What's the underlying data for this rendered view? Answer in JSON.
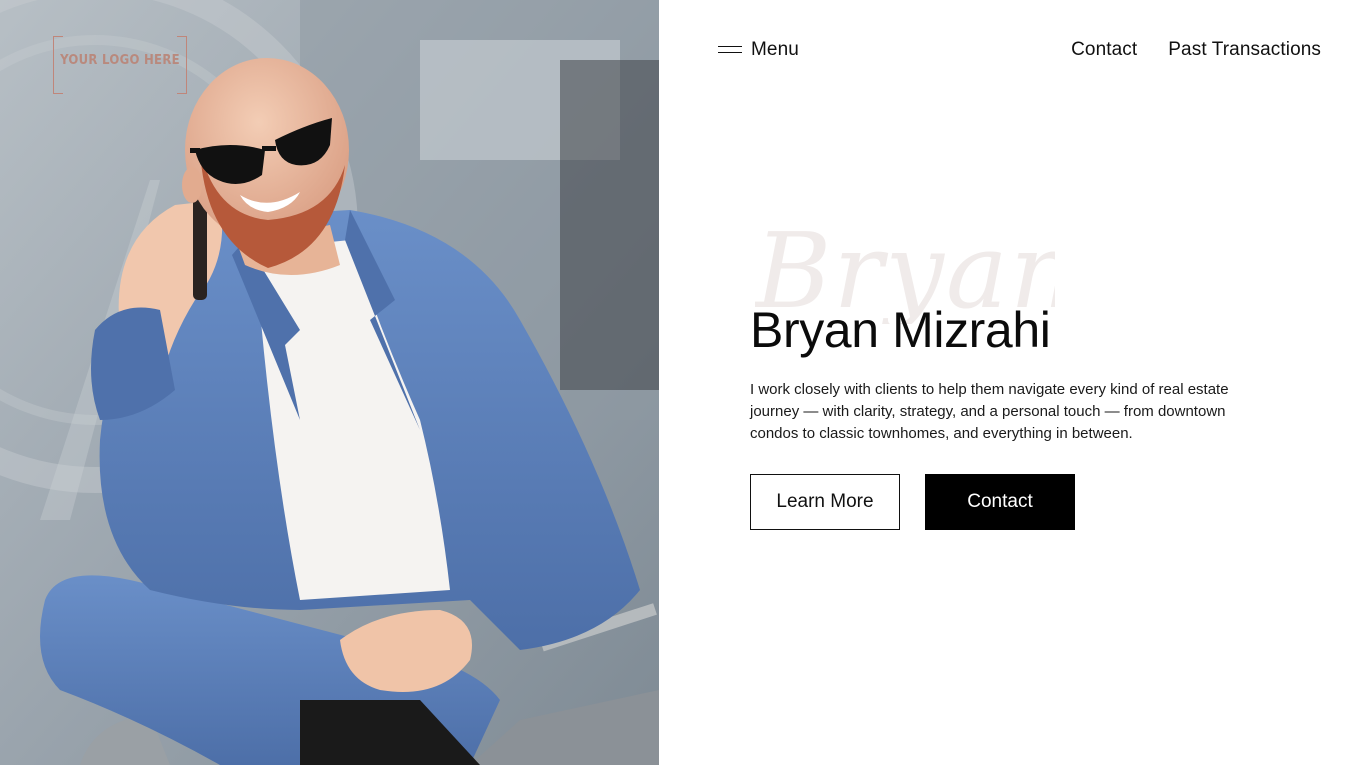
{
  "logo": {
    "text": "YOUR LOGO HERE"
  },
  "nav": {
    "menu_label": "Menu",
    "links": [
      {
        "label": "Contact"
      },
      {
        "label": "Past Transactions"
      }
    ]
  },
  "hero": {
    "script_watermark": "Bryan",
    "title": "Bryan Mizrahi",
    "description": "I work closely with clients to help them navigate every kind of real estate journey — with clarity, strategy, and a personal touch — from downtown condos to classic townhomes, and everything in between.",
    "primary_button": "Learn More",
    "secondary_button": "Contact"
  },
  "colors": {
    "text": "#111111",
    "button_solid_bg": "#000000",
    "button_solid_text": "#ffffff",
    "logo_accent": "#c0867a",
    "watermark": "#f0ebea",
    "suit_blue": "#5b7fba"
  },
  "icons": {
    "menu": "hamburger-icon"
  }
}
